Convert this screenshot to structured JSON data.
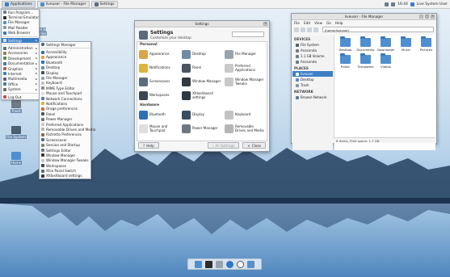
{
  "top_panel": {
    "tasks": [
      {
        "label": "Applications",
        "active": true
      },
      {
        "label": "liveuser - File Manager",
        "active": false
      },
      {
        "label": "Settings",
        "active": false
      }
    ],
    "clock": "16:44",
    "user": "Live System User"
  },
  "desktop_icons": {
    "partial": "all to\nDrive",
    "trash": "Trash",
    "file_system": "File System",
    "home": "Home"
  },
  "app_menu": {
    "items": [
      {
        "label": "Run Program...",
        "icon": "run-icon"
      },
      {
        "label": "Terminal Emulator",
        "icon": "terminal-icon"
      },
      {
        "label": "File Manager",
        "icon": "folder-icon"
      },
      {
        "label": "Mail Reader",
        "icon": "mail-icon"
      },
      {
        "label": "Web Browser",
        "icon": "globe-icon"
      },
      {
        "label": "Settings",
        "icon": "settings-icon",
        "submenu": true,
        "selected": true
      },
      {
        "label": "Administration",
        "icon": "admin-icon",
        "submenu": true
      },
      {
        "label": "Accessories",
        "icon": "accessories-icon",
        "submenu": true
      },
      {
        "label": "Development",
        "icon": "development-icon",
        "submenu": true
      },
      {
        "label": "Documentation",
        "icon": "documentation-icon",
        "submenu": true
      },
      {
        "label": "Graphics",
        "icon": "graphics-icon",
        "submenu": true
      },
      {
        "label": "Internet",
        "icon": "internet-icon",
        "submenu": true
      },
      {
        "label": "Multimedia",
        "icon": "multimedia-icon",
        "submenu": true
      },
      {
        "label": "Office",
        "icon": "office-icon",
        "submenu": true
      },
      {
        "label": "System",
        "icon": "system-icon",
        "submenu": true
      },
      {
        "label": "Log Out",
        "icon": "logout-icon"
      }
    ]
  },
  "settings_submenu": {
    "items": [
      "Settings Manager",
      "Accessibility",
      "Appearance",
      "Bluetooth",
      "Desktop",
      "Display",
      "File Manager",
      "Keyboard",
      "MIME Type Editor",
      "Mouse and Touchpad",
      "Network Connections",
      "Notifications",
      "Orage preferences",
      "Panel",
      "Power Manager",
      "Preferred Applications",
      "Removable Drives and Media",
      "Ristretto Preferences",
      "Screensaver",
      "Session and Startup",
      "Settings Editor",
      "Window Manager",
      "Window Manager Tweaks",
      "Workspaces",
      "Xfce Panel Switch",
      "Xfdashboard settings"
    ]
  },
  "settings_window": {
    "title": "Settings",
    "header_title": "Settings",
    "header_subtitle": "Customize your desktop",
    "search_placeholder": "",
    "categories": [
      {
        "name": "Personal",
        "items": [
          {
            "label": "Appearance",
            "color": "#d8a64a"
          },
          {
            "label": "Desktop",
            "color": "#6f8aa8"
          },
          {
            "label": "File Manager",
            "color": "#9aa3ad"
          },
          {
            "label": "Notifications",
            "color": "#e0b33f"
          },
          {
            "label": "Panel",
            "color": "#4a5561"
          },
          {
            "label": "Preferred Applications",
            "color": "#c9c9c9"
          },
          {
            "label": "Screensaver",
            "color": "#5a6b7c"
          },
          {
            "label": "Window Manager",
            "color": "#33393f"
          },
          {
            "label": "Window Manager Tweaks",
            "color": "#c7c7c7"
          },
          {
            "label": "Workspaces",
            "color": "#3d4650"
          },
          {
            "label": "Xfdashboard settings",
            "color": "#2f3842"
          }
        ]
      },
      {
        "name": "Hardware",
        "items": [
          {
            "label": "Bluetooth",
            "color": "#2f6fb6"
          },
          {
            "label": "Display",
            "color": "#3b4d60"
          },
          {
            "label": "Keyboard",
            "color": "#c3c3c3"
          },
          {
            "label": "Mouse and Touchpad",
            "color": "#dfdfdf"
          },
          {
            "label": "Power Manager",
            "color": "#6e7781"
          },
          {
            "label": "Removable Drives and Media",
            "color": "#b5b5b5"
          }
        ]
      }
    ],
    "help_label": "Help",
    "all_settings_label": "All Settings",
    "close_label": "Close"
  },
  "file_manager": {
    "title": "liveuser - File Manager",
    "menu": [
      "File",
      "Edit",
      "View",
      "Go",
      "Help"
    ],
    "path": "/home/liveuser/",
    "sections": {
      "devices": "DEVICES",
      "places": "PLACES",
      "network": "NETWORK"
    },
    "devices": [
      "File System",
      "Anaconda",
      "1.1 GB Volume",
      "Anaconda"
    ],
    "places": [
      {
        "label": "liveuser",
        "selected": true
      },
      {
        "label": "Desktop",
        "selected": false
      },
      {
        "label": "Trash",
        "selected": false
      }
    ],
    "network": [
      "Browse Network"
    ],
    "folders": [
      "Desktop",
      "Documents",
      "Downloads",
      "Music",
      "Pictures",
      "Public",
      "Templates",
      "Videos"
    ],
    "status": "8 items, Free space: 1.7 GB"
  },
  "dock": {
    "items": [
      "folder-icon",
      "terminal-icon",
      "file-manager-icon",
      "browser-icon",
      "search-icon",
      "directory-icon"
    ]
  },
  "colors": {
    "accent": "#3d7fc6",
    "folder": "#4f8fcf"
  }
}
